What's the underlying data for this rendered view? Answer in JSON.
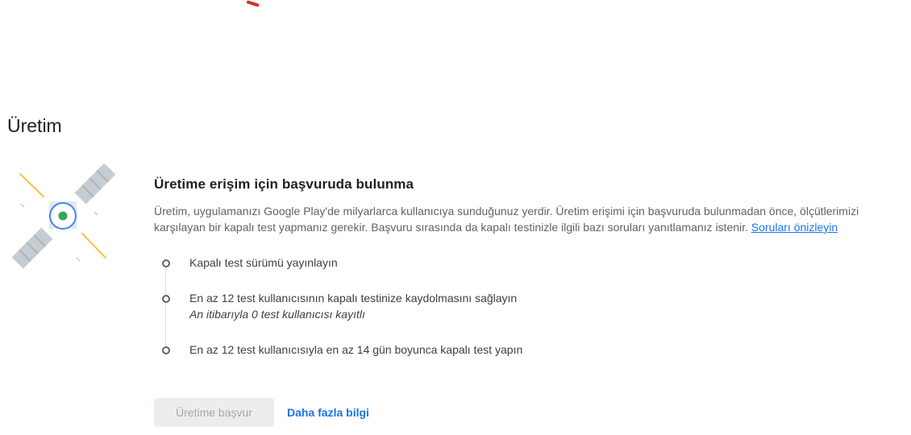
{
  "page": {
    "title": "Üretim"
  },
  "section": {
    "title": "Üretime erişim için başvuruda bulunma",
    "description": "Üretim, uygulamanızı Google Play'de milyarlarca kullanıcıya sunduğunuz yerdir. Üretim erişimi için başvuruda bulunmadan önce, ölçütlerimizi karşılayan bir kapalı test yapmanız gerekir. Başvuru sırasında da kapalı testinizle ilgili bazı soruları yanıtlamanız istenir.",
    "preview_link": "Soruları önizleyin"
  },
  "steps": [
    {
      "label": "Kapalı test sürümü yayınlayın"
    },
    {
      "label": "En az 12 test kullanıcısının kapalı testinize kaydolmasını sağlayın",
      "sub": "An itibarıyla 0 test kullanıcısı kayıtlı"
    },
    {
      "label": "En az 12 test kullanıcısıyla en az 14 gün boyunca kapalı test yapın"
    }
  ],
  "actions": {
    "apply_label": "Üretime başvur",
    "more_label": "Daha fazla bilgi"
  },
  "illustration": {
    "icon": "satellite-icon",
    "colors": {
      "panel": "#c5cdd3",
      "panel_dark": "#aab4bc",
      "ray": "#f6c344",
      "ring": "#4285f4",
      "core": "#34a853"
    }
  }
}
